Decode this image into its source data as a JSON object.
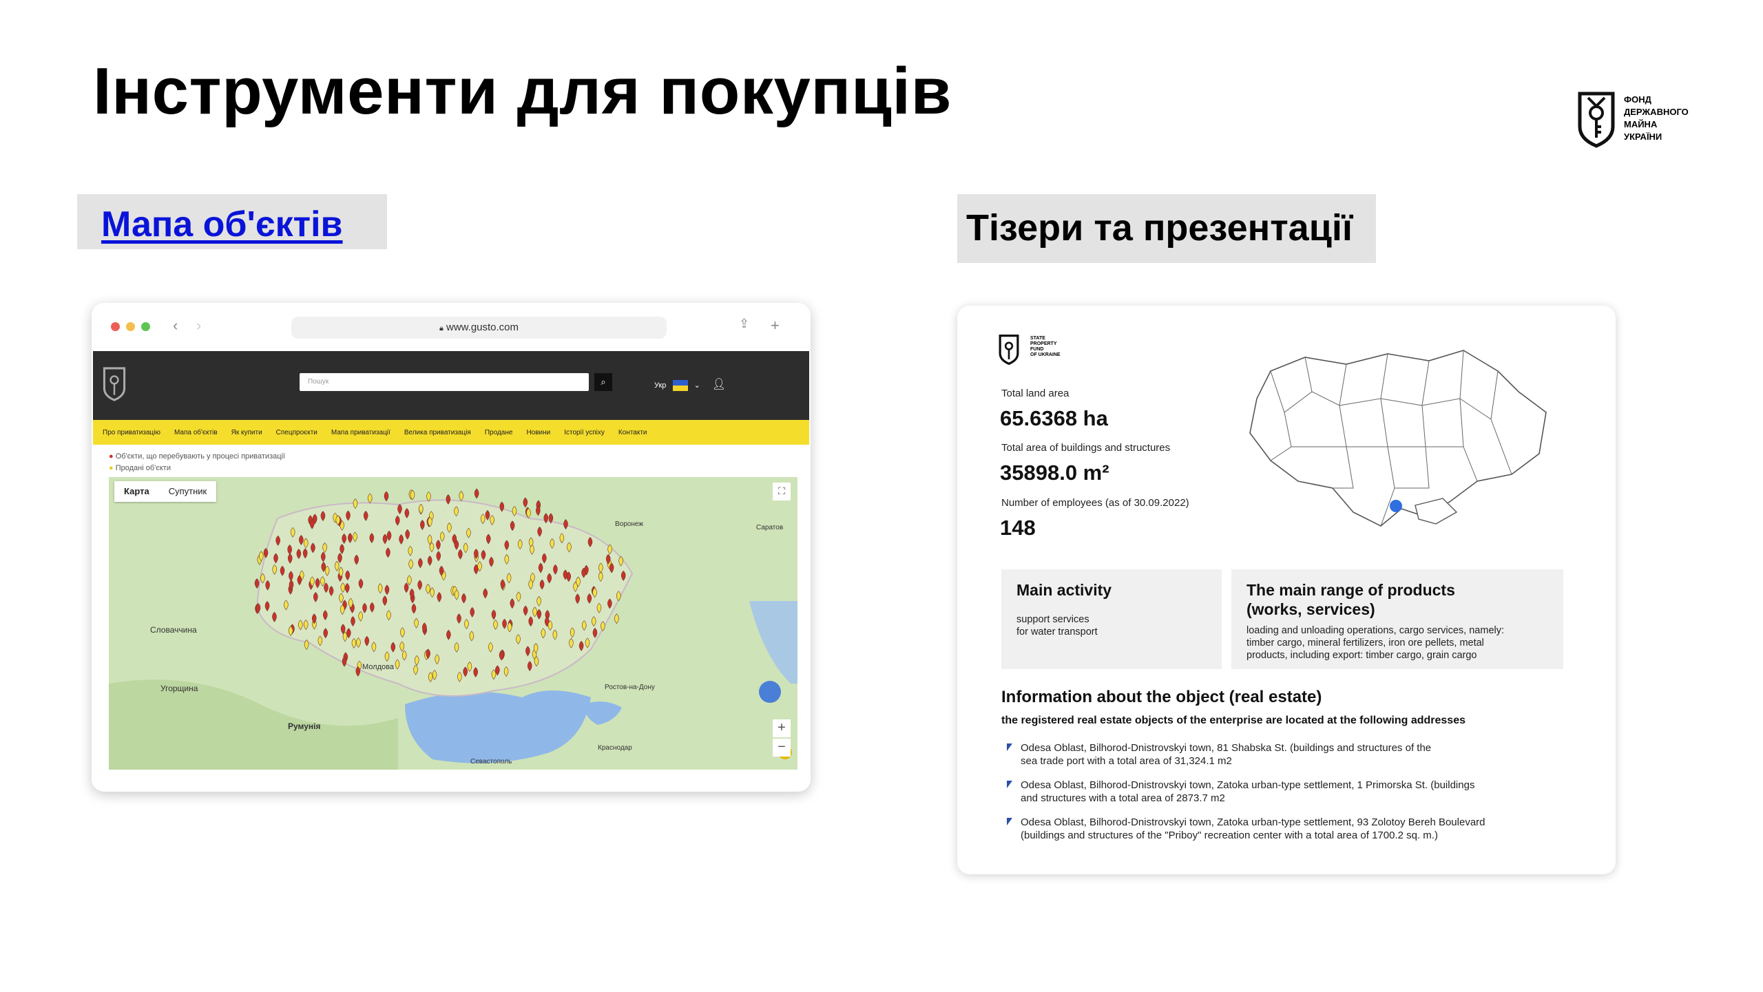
{
  "title": "Інструменти для покупців",
  "logo": {
    "icon": "key-shield-logo",
    "text": "ФОНД\nДЕРЖАВНОГО\nМАЙНА\nУКРАЇНИ"
  },
  "sections": {
    "map_link": "Мапа об'єктів",
    "teasers": "Тізери та презентації"
  },
  "browser": {
    "url": "www.gusto.com",
    "site_search_placeholder": "Пошук",
    "lang": "Укр",
    "nav": [
      "Про приватизацію",
      "Мапа об'єктів",
      "Як купити",
      "Спецпроєкти",
      "Мапа приватизації",
      "Велика приватизація",
      "Продане",
      "Новини",
      "Історії успіху",
      "Контакти"
    ],
    "legend": [
      "Об'єкти, що перебувають у процесі приватизації",
      "Продані об'єкти"
    ],
    "map_tabs": [
      "Карта",
      "Супутник"
    ],
    "map_labels": [
      "Молдова",
      "Румунія",
      "Словаччина",
      "Угорщина",
      "Воронеж",
      "Саратов",
      "Ростов-на-Дону",
      "Севастополь",
      "Краснодар"
    ]
  },
  "teaser": {
    "fund_label": "STATE\nPROPERTY\nFUND\nOF UKRAINE",
    "land_label": "Total land area",
    "land_value": "65.6368 ha",
    "buildings_label": "Total area of buildings and structures",
    "buildings_value": "35898.0 m²",
    "employees_label": "Number of employees (as of 30.09.2022)",
    "employees_value": "148",
    "main_activity_title": "Main activity",
    "main_activity_text": "support services\nfor water transport",
    "products_title": "The main range of products\n(works, services)",
    "products_text": "loading and unloading operations, cargo services, namely:\ntimber cargo, mineral fertilizers, iron ore pellets, metal\nproducts, including export: timber cargo, grain cargo",
    "info_title": "Information about the object (real estate)",
    "info_subtitle": "the registered real estate objects of the enterprise are located at the following addresses",
    "addresses": [
      "Odesa Oblast, Bilhorod-Dnistrovskyi town, 81 Shabska St. (buildings and structures of the\nsea trade port with a total area of 31,324.1 m2",
      "Odesa Oblast, Bilhorod-Dnistrovskyi town, Zatoka urban-type settlement, 1 Primorska St. (buildings\nand structures with a total area of 2873.7 m2",
      "Odesa Oblast, Bilhorod-Dnistrovskyi town, Zatoka urban-type settlement, 93 Zolotoy Bereh Boulevard\n(buildings and structures of the \"Priboy\" recreation center with a total area of 1700.2 sq. m.)"
    ]
  },
  "colors": {
    "link": "#0a14d8",
    "tag_bg": "#e3e3e3",
    "site_yellow": "#f5dd2c",
    "site_dark": "#2d2d2d",
    "marker_red": "#c8332b",
    "marker_yellow": "#f2e14a",
    "highlight_dot": "#2f6fe0"
  }
}
